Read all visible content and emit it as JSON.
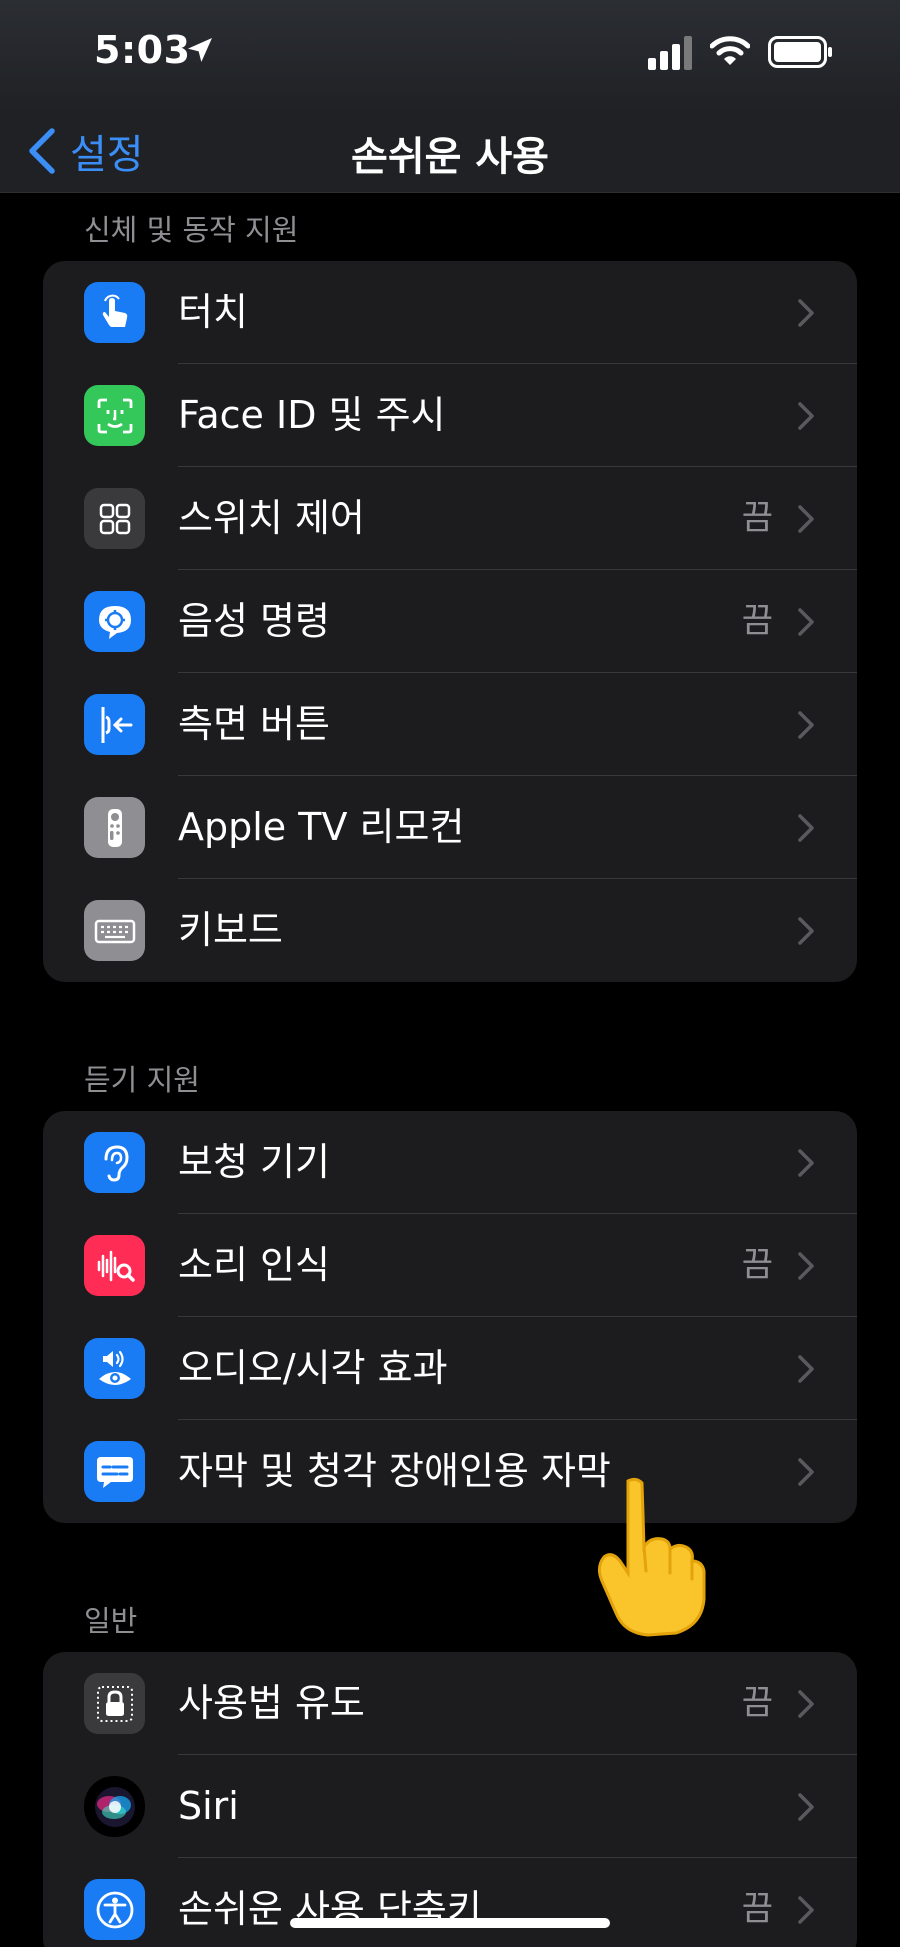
{
  "status_bar": {
    "time": "5:03"
  },
  "nav": {
    "back_label": "설정",
    "title": "손쉬운 사용"
  },
  "sections": [
    {
      "header": "신체 및 동작 지원",
      "items": [
        {
          "label": "터치",
          "value": "",
          "icon": "touch-hand-icon",
          "color": "#1a7cf5"
        },
        {
          "label": "Face ID 및 주시",
          "value": "",
          "icon": "face-id-icon",
          "color": "#34c759"
        },
        {
          "label": "스위치 제어",
          "value": "끔",
          "icon": "switch-grid-icon",
          "color": "#3a3a3c"
        },
        {
          "label": "음성 명령",
          "value": "끔",
          "icon": "voice-control-icon",
          "color": "#1a7cf5"
        },
        {
          "label": "측면 버튼",
          "value": "",
          "icon": "side-button-icon",
          "color": "#1a7cf5"
        },
        {
          "label": "Apple TV 리모컨",
          "value": "",
          "icon": "tv-remote-icon",
          "color": "#8e8e93"
        },
        {
          "label": "키보드",
          "value": "",
          "icon": "keyboard-icon",
          "color": "#8e8e93"
        }
      ]
    },
    {
      "header": "듣기 지원",
      "items": [
        {
          "label": "보청 기기",
          "value": "",
          "icon": "ear-icon",
          "color": "#1a7cf5"
        },
        {
          "label": "소리 인식",
          "value": "끔",
          "icon": "sound-recognition-icon",
          "color": "#ff2d55"
        },
        {
          "label": "오디오/시각 효과",
          "value": "",
          "icon": "audio-visual-icon",
          "color": "#1a7cf5"
        },
        {
          "label": "자막 및 청각 장애인용 자막",
          "value": "",
          "icon": "subtitles-icon",
          "color": "#1a7cf5"
        }
      ]
    },
    {
      "header": "일반",
      "items": [
        {
          "label": "사용법 유도",
          "value": "끔",
          "icon": "guided-access-lock-icon",
          "color": "#3a3a3c"
        },
        {
          "label": "Siri",
          "value": "",
          "icon": "siri-icon",
          "color": "#1c1c1e"
        },
        {
          "label": "손쉬운 사용 단축키",
          "value": "끔",
          "icon": "accessibility-person-icon",
          "color": "#1a7cf5"
        }
      ]
    }
  ]
}
